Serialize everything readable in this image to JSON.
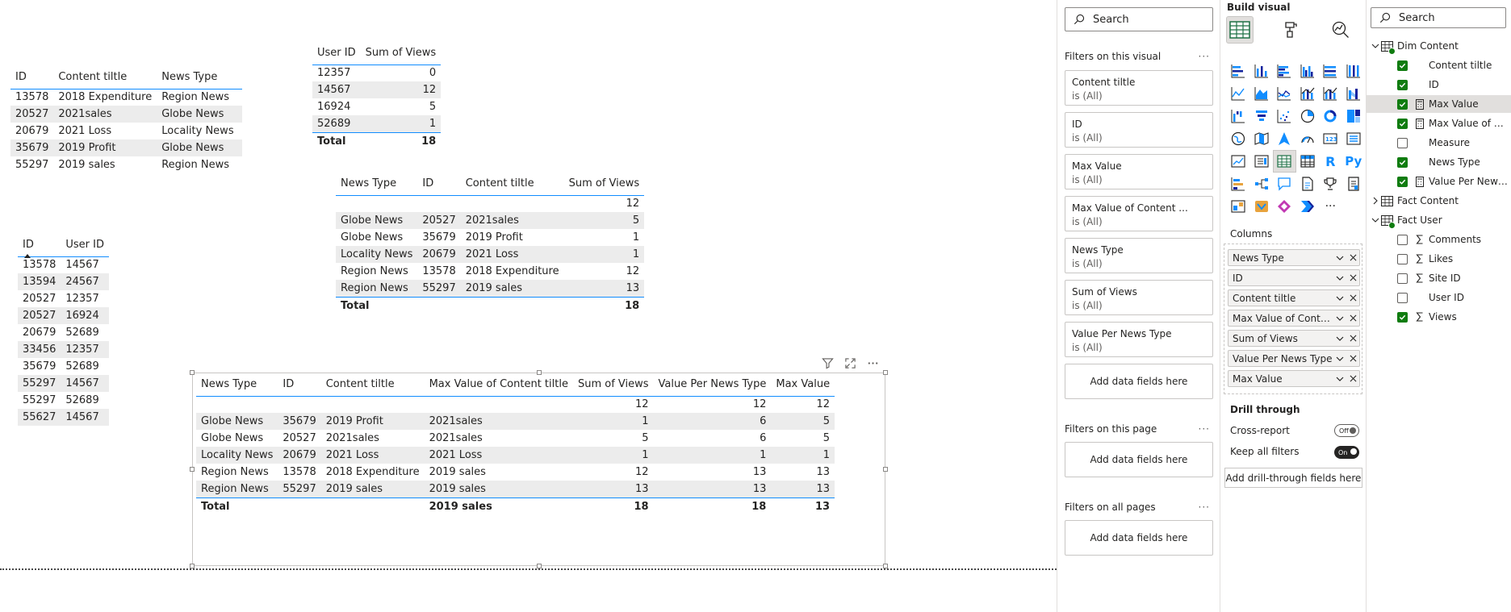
{
  "tables": {
    "content": {
      "headers": [
        "ID",
        "Content tiltle",
        "News Type"
      ],
      "rows": [
        [
          "13578",
          "2018 Expenditure",
          "Region News"
        ],
        [
          "20527",
          "2021sales",
          "Globe News"
        ],
        [
          "20679",
          "2021 Loss",
          "Locality News"
        ],
        [
          "35679",
          "2019 Profit",
          "Globe News"
        ],
        [
          "55297",
          "2019 sales",
          "Region News"
        ]
      ]
    },
    "user_views": {
      "headers": [
        "User ID",
        "Sum of Views"
      ],
      "rows": [
        [
          "12357",
          "0"
        ],
        [
          "14567",
          "12"
        ],
        [
          "16924",
          "5"
        ],
        [
          "52689",
          "1"
        ]
      ],
      "total": [
        "Total",
        "18"
      ]
    },
    "id_user": {
      "headers": [
        "ID",
        "User ID"
      ],
      "rows": [
        [
          "13578",
          "14567"
        ],
        [
          "13594",
          "24567"
        ],
        [
          "20527",
          "12357"
        ],
        [
          "20527",
          "16924"
        ],
        [
          "20679",
          "52689"
        ],
        [
          "33456",
          "12357"
        ],
        [
          "35679",
          "52689"
        ],
        [
          "55297",
          "14567"
        ],
        [
          "55297",
          "52689"
        ],
        [
          "55627",
          "14567"
        ]
      ]
    },
    "news_views": {
      "headers": [
        "News Type",
        "ID",
        "Content tiltle",
        "Sum of Views"
      ],
      "rows": [
        [
          "",
          "",
          "",
          "12"
        ],
        [
          "Globe News",
          "20527",
          "2021sales",
          "5"
        ],
        [
          "Globe News",
          "35679",
          "2019 Profit",
          "1"
        ],
        [
          "Locality News",
          "20679",
          "2021 Loss",
          "1"
        ],
        [
          "Region News",
          "13578",
          "2018 Expenditure",
          "12"
        ],
        [
          "Region News",
          "55297",
          "2019 sales",
          "13"
        ]
      ],
      "total": [
        "Total",
        "",
        "",
        "18"
      ]
    },
    "selected": {
      "headers": [
        "News Type",
        "ID",
        "Content tiltle",
        "Max Value of Content tiltle",
        "Sum of Views",
        "Value Per News Type",
        "Max Value"
      ],
      "rows": [
        [
          "",
          "",
          "",
          "",
          "12",
          "12",
          "12"
        ],
        [
          "Globe News",
          "35679",
          "2019 Profit",
          "2021sales",
          "1",
          "6",
          "5"
        ],
        [
          "Globe News",
          "20527",
          "2021sales",
          "2021sales",
          "5",
          "6",
          "5"
        ],
        [
          "Locality News",
          "20679",
          "2021 Loss",
          "2021 Loss",
          "1",
          "1",
          "1"
        ],
        [
          "Region News",
          "13578",
          "2018 Expenditure",
          "2019 sales",
          "12",
          "13",
          "13"
        ],
        [
          "Region News",
          "55297",
          "2019 sales",
          "2019 sales",
          "13",
          "13",
          "13"
        ]
      ],
      "total": [
        "Total",
        "",
        "",
        "2019 sales",
        "18",
        "18",
        "13"
      ]
    }
  },
  "filters_pane": {
    "search_placeholder": "Search",
    "on_visual_title": "Filters on this visual",
    "more": "···",
    "cards": [
      {
        "name": "Content tiltle",
        "state": "is (All)"
      },
      {
        "name": "ID",
        "state": "is (All)"
      },
      {
        "name": "Max Value",
        "state": "is (All)"
      },
      {
        "name": "Max Value of Content ...",
        "state": "is (All)"
      },
      {
        "name": "News Type",
        "state": "is (All)"
      },
      {
        "name": "Sum of Views",
        "state": "is (All)"
      },
      {
        "name": "Value Per News Type",
        "state": "is (All)"
      }
    ],
    "add_fields": "Add data fields here",
    "on_page_title": "Filters on this page",
    "all_pages_title": "Filters on all pages"
  },
  "viz_pane": {
    "title": "Build visual",
    "more_visuals": "···",
    "columns_label": "Columns",
    "column_fields": [
      "News Type",
      "ID",
      "Content tiltle",
      "Max Value of Content...",
      "Sum of Views",
      "Value Per News Type",
      "Max Value"
    ],
    "drill_title": "Drill through",
    "cross_report": "Cross-report",
    "cross_report_state": "Off",
    "keep_filters": "Keep all filters",
    "keep_filters_state": "On",
    "drill_drop": "Add drill-through fields here",
    "r_label": "R",
    "py_label": "Py"
  },
  "data_pane": {
    "search_placeholder": "Search",
    "tables": [
      {
        "name": "Dim Content",
        "expanded": true,
        "fields": [
          {
            "name": "Content tiltle",
            "checked": true,
            "type": ""
          },
          {
            "name": "ID",
            "checked": true,
            "type": ""
          },
          {
            "name": "Max Value",
            "checked": true,
            "type": "measure"
          },
          {
            "name": "Max Value of Co...",
            "checked": true,
            "type": "measure"
          },
          {
            "name": "Measure",
            "checked": false,
            "type": ""
          },
          {
            "name": "News Type",
            "checked": true,
            "type": ""
          },
          {
            "name": "Value Per News T...",
            "checked": true,
            "type": "measure"
          }
        ]
      },
      {
        "name": "Fact Content",
        "expanded": false,
        "fields": []
      },
      {
        "name": "Fact User",
        "expanded": true,
        "fields": [
          {
            "name": "Comments",
            "checked": false,
            "type": "sum"
          },
          {
            "name": "Likes",
            "checked": false,
            "type": "sum"
          },
          {
            "name": "Site ID",
            "checked": false,
            "type": "sum"
          },
          {
            "name": "User ID",
            "checked": false,
            "type": ""
          },
          {
            "name": "Views",
            "checked": true,
            "type": "sum"
          }
        ]
      }
    ]
  },
  "colors": {
    "accent": "#118dff",
    "check_green": "#107c10",
    "row_alt": "#ececec",
    "border": "#c8c6c4"
  }
}
